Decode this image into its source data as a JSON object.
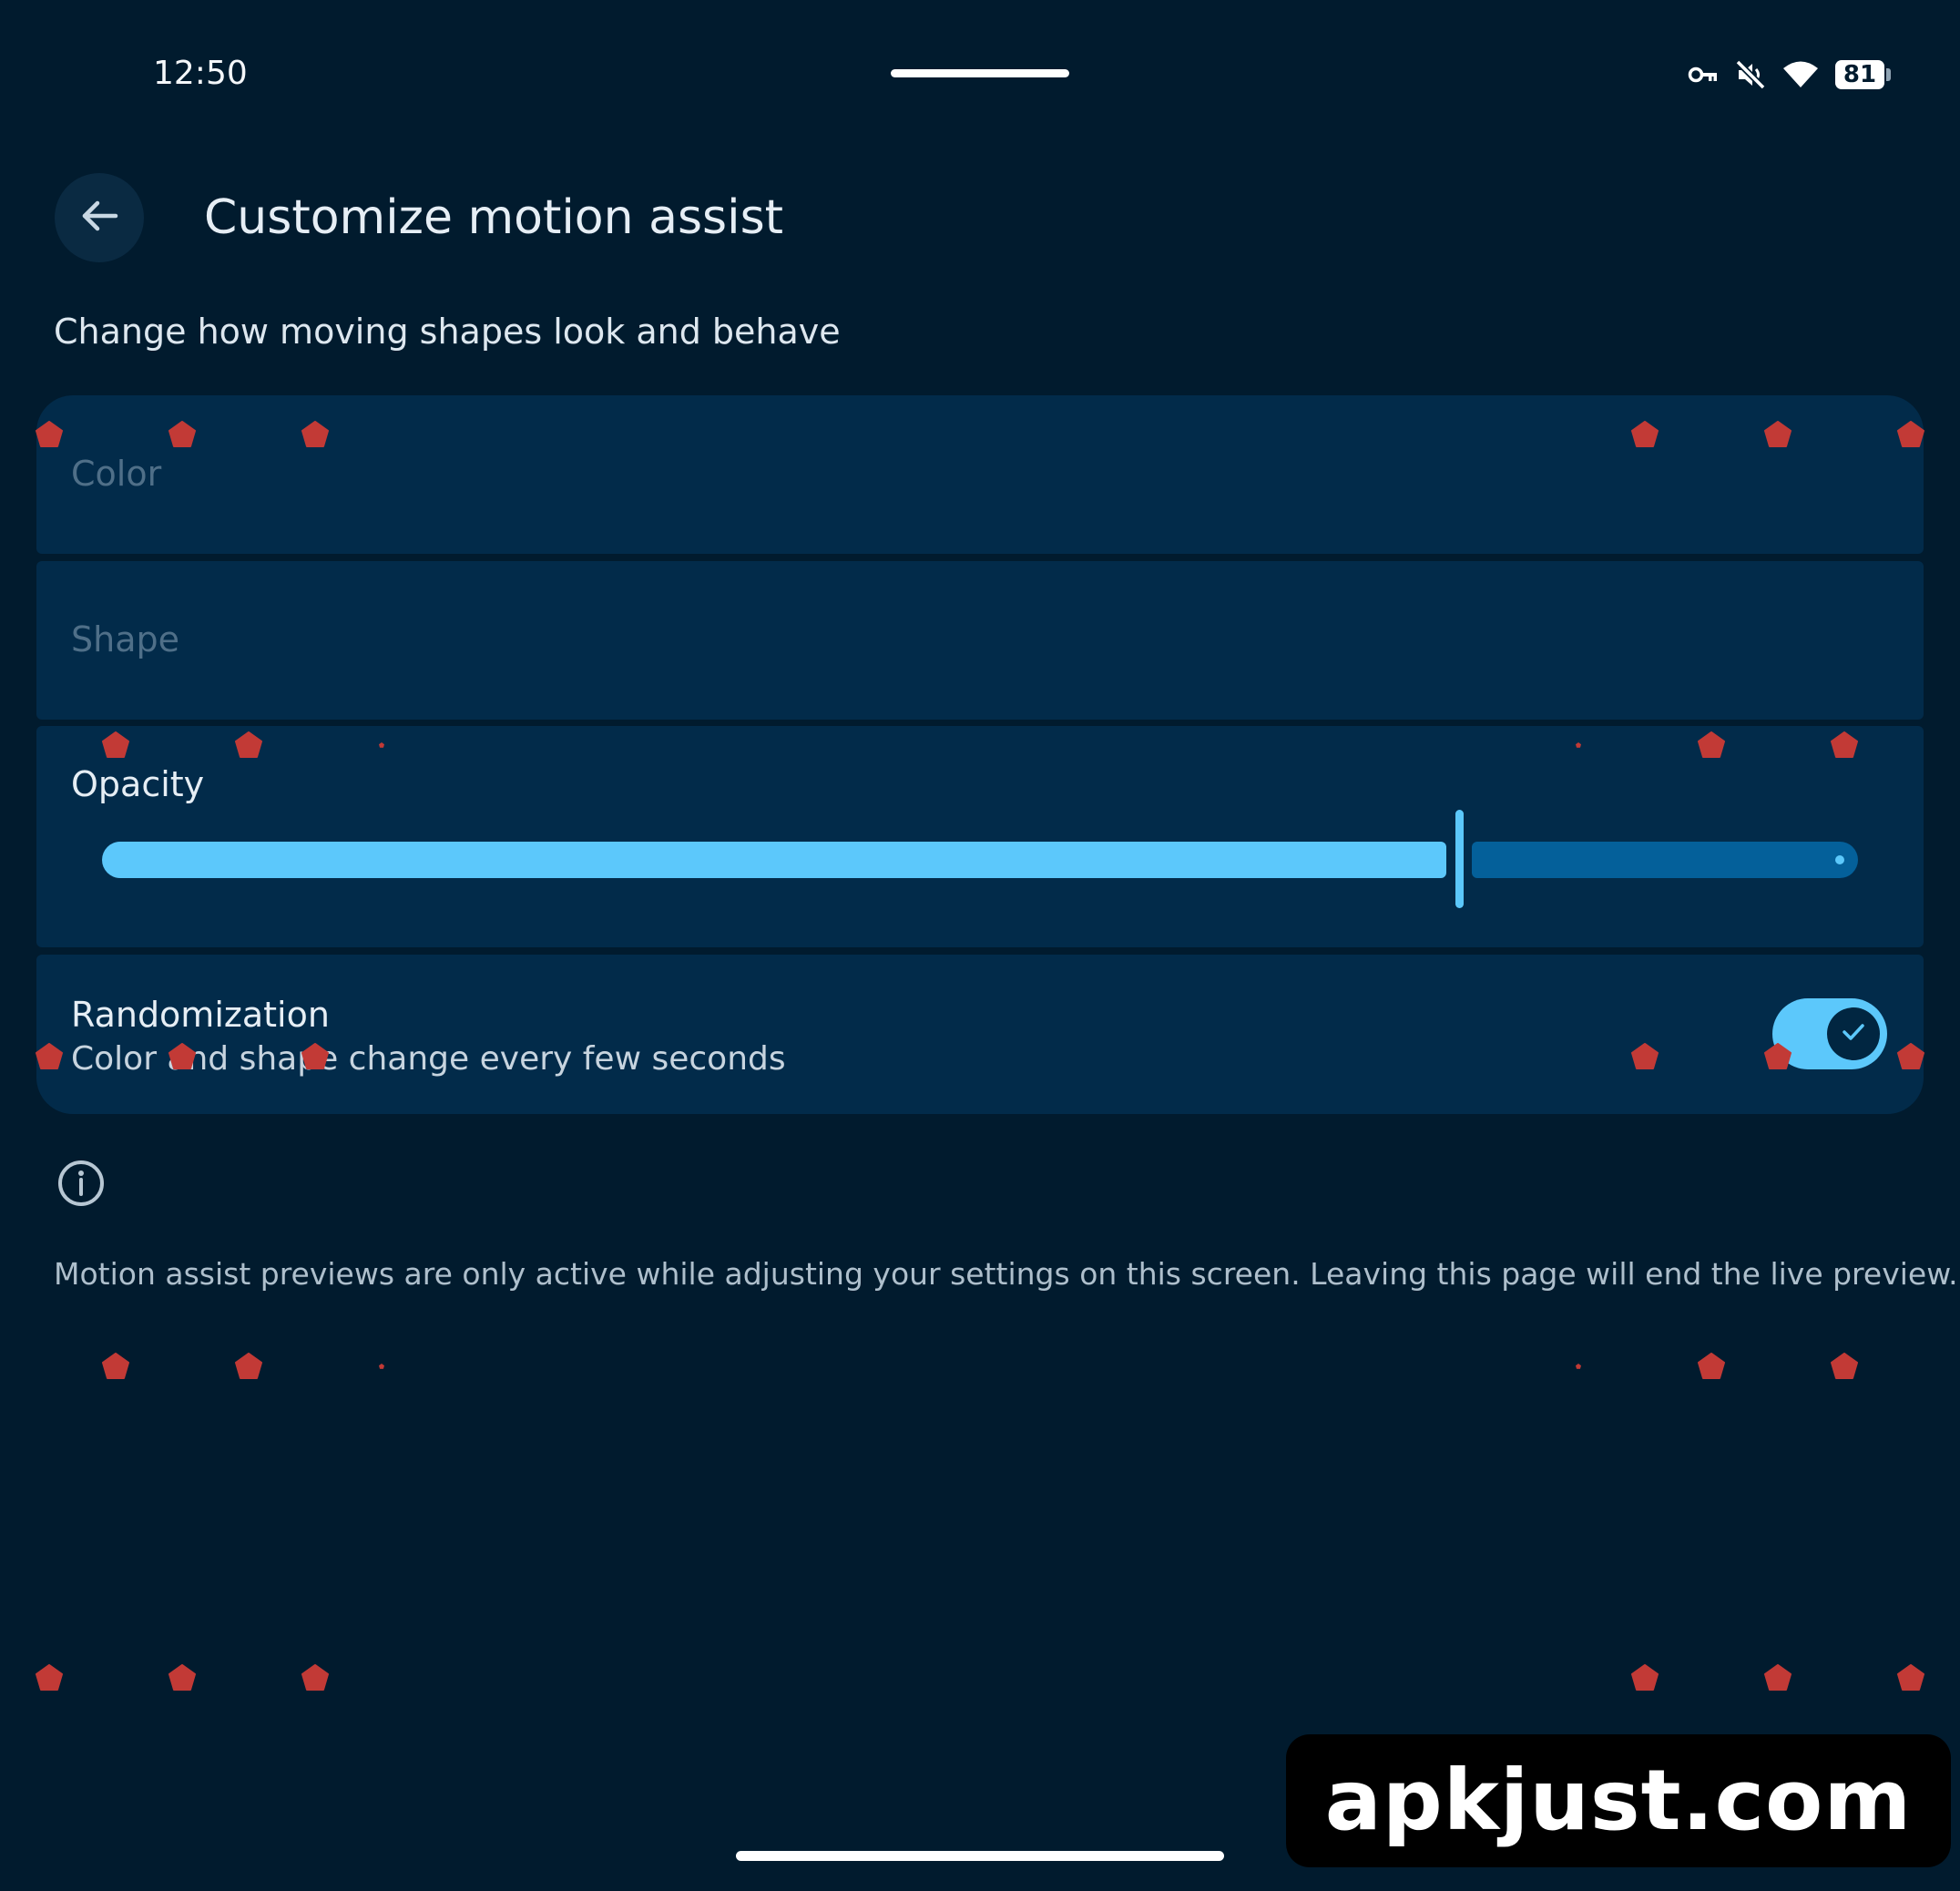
{
  "status_bar": {
    "time": "12:50",
    "battery_level": "81",
    "icons": [
      "vpn-key-icon",
      "muted-icon",
      "wifi-icon",
      "battery-icon"
    ]
  },
  "header": {
    "title": "Customize motion assist",
    "back_icon": "arrow-back-icon"
  },
  "subtitle": "Change how moving shapes look and behave",
  "settings": {
    "color": {
      "label": "Color",
      "enabled": false
    },
    "shape": {
      "label": "Shape",
      "enabled": false
    },
    "opacity": {
      "label": "Opacity",
      "value": 0.77
    },
    "randomization": {
      "label": "Randomization",
      "description": "Color and shape change every few seconds",
      "enabled": true
    }
  },
  "info": {
    "icon": "info-icon",
    "text": "Motion assist previews are only active while adjusting your settings on this screen. Leaving this page will end the live preview."
  },
  "watermark": "apkjust.com",
  "colors": {
    "background": "#011b2e",
    "card": "#022b4a",
    "accent": "#5cc8fb",
    "track_inactive": "#04609a",
    "preview_dot": "#c23a36"
  }
}
